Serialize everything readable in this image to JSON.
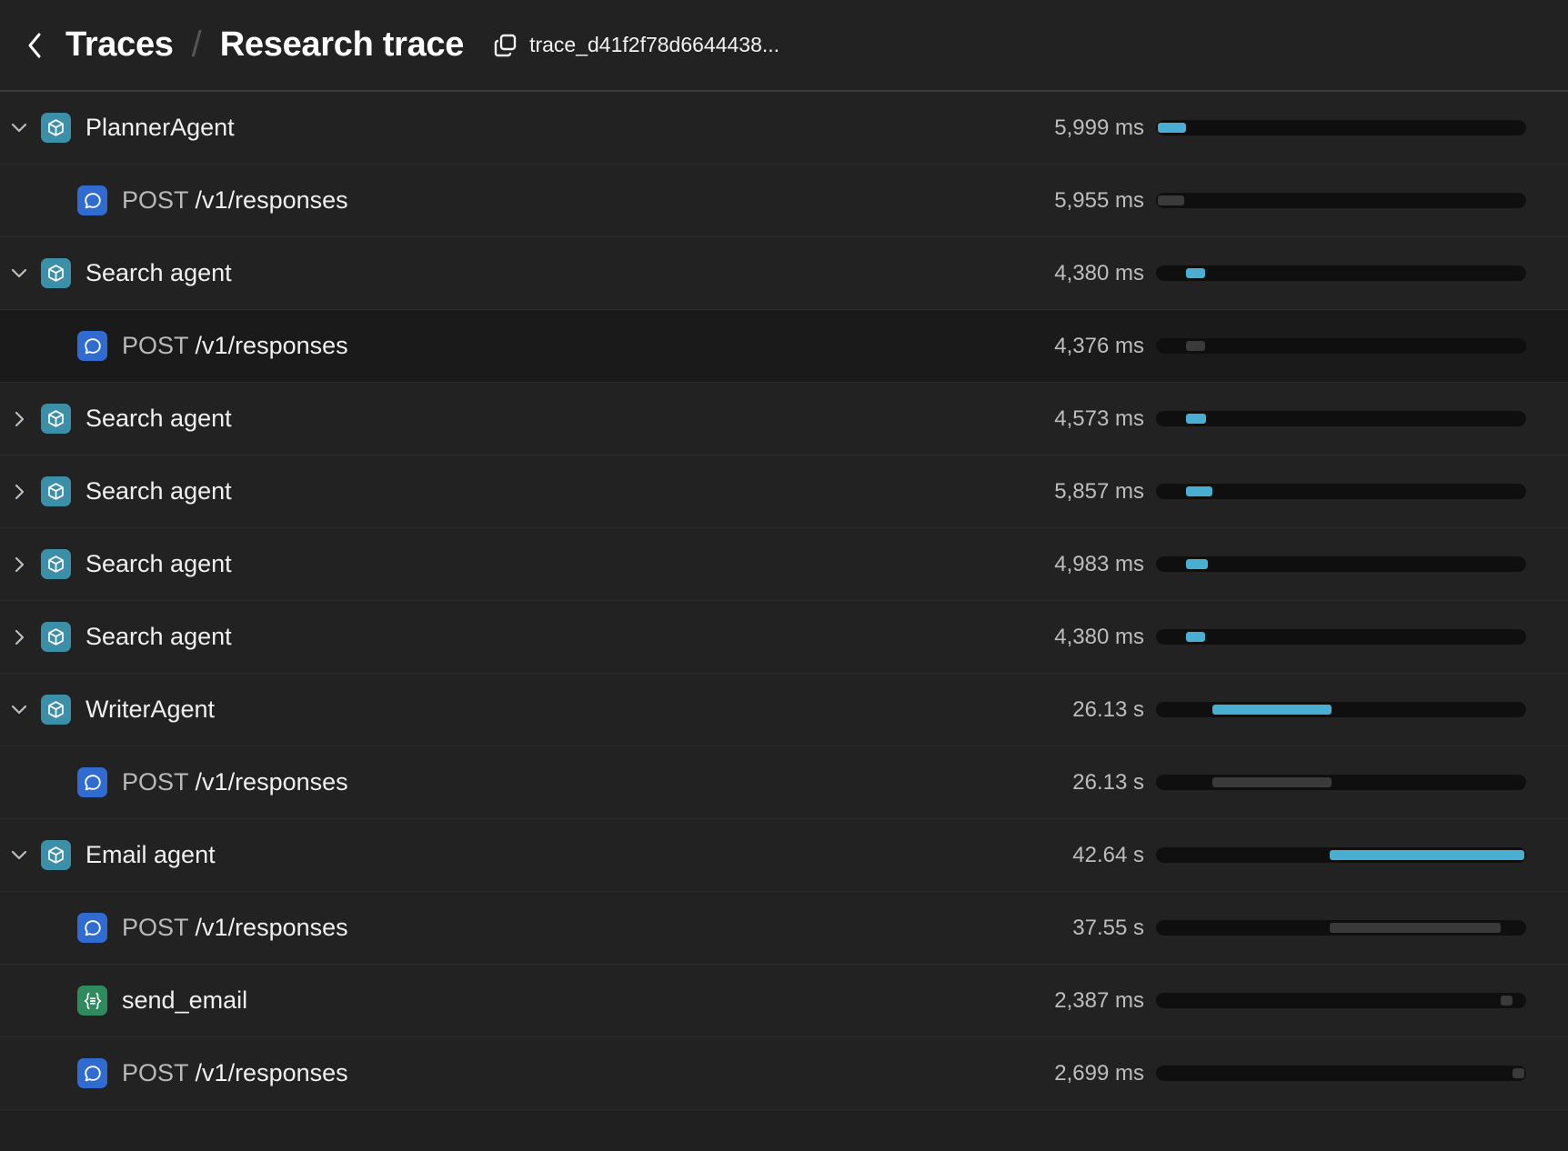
{
  "header": {
    "back_icon": "chevron-left-icon",
    "breadcrumb_root": "Traces",
    "breadcrumb_separator": "/",
    "title": "Research trace",
    "copy_icon": "copy-icon",
    "trace_id": "trace_d41f2f78d6644438..."
  },
  "colors": {
    "background": "#202020",
    "agent_icon": "#3c8fa8",
    "response_icon": "#2f6bd0",
    "function_icon": "#2f8a5e",
    "bar_active": "#4aaed0",
    "bar_inactive": "#3a3a3a",
    "bar_track": "#0f0f0f"
  },
  "spans": [
    {
      "kind": "agent",
      "level": 1,
      "expand": "expanded",
      "method": "",
      "name": "PlannerAgent",
      "duration": "5,999 ms",
      "bar_start": 0.005,
      "bar_width": 0.075,
      "bar_color": "blue",
      "selected": false
    },
    {
      "kind": "response",
      "level": 2,
      "expand": "none",
      "method": "POST",
      "name": "/v1/responses",
      "duration": "5,955 ms",
      "bar_start": 0.005,
      "bar_width": 0.072,
      "bar_color": "gray",
      "selected": false
    },
    {
      "kind": "agent",
      "level": 1,
      "expand": "expanded",
      "method": "",
      "name": "Search agent",
      "duration": "4,380 ms",
      "bar_start": 0.08,
      "bar_width": 0.053,
      "bar_color": "blue",
      "selected": false
    },
    {
      "kind": "response",
      "level": 2,
      "expand": "none",
      "method": "POST",
      "name": "/v1/responses",
      "duration": "4,376 ms",
      "bar_start": 0.08,
      "bar_width": 0.053,
      "bar_color": "gray",
      "selected": true
    },
    {
      "kind": "agent",
      "level": 1,
      "expand": "collapsed",
      "method": "",
      "name": "Search agent",
      "duration": "4,573 ms",
      "bar_start": 0.08,
      "bar_width": 0.055,
      "bar_color": "blue",
      "selected": false
    },
    {
      "kind": "agent",
      "level": 1,
      "expand": "collapsed",
      "method": "",
      "name": "Search agent",
      "duration": "5,857 ms",
      "bar_start": 0.08,
      "bar_width": 0.072,
      "bar_color": "blue",
      "selected": false
    },
    {
      "kind": "agent",
      "level": 1,
      "expand": "collapsed",
      "method": "",
      "name": "Search agent",
      "duration": "4,983 ms",
      "bar_start": 0.08,
      "bar_width": 0.06,
      "bar_color": "blue",
      "selected": false
    },
    {
      "kind": "agent",
      "level": 1,
      "expand": "collapsed",
      "method": "",
      "name": "Search agent",
      "duration": "4,380 ms",
      "bar_start": 0.08,
      "bar_width": 0.053,
      "bar_color": "blue",
      "selected": false
    },
    {
      "kind": "agent",
      "level": 1,
      "expand": "expanded",
      "method": "",
      "name": "WriterAgent",
      "duration": "26.13 s",
      "bar_start": 0.153,
      "bar_width": 0.32,
      "bar_color": "blue",
      "selected": false
    },
    {
      "kind": "response",
      "level": 2,
      "expand": "none",
      "method": "POST",
      "name": "/v1/responses",
      "duration": "26.13 s",
      "bar_start": 0.153,
      "bar_width": 0.32,
      "bar_color": "gray",
      "selected": false
    },
    {
      "kind": "agent",
      "level": 1,
      "expand": "expanded",
      "method": "",
      "name": "Email agent",
      "duration": "42.64 s",
      "bar_start": 0.47,
      "bar_width": 0.525,
      "bar_color": "blue",
      "selected": false
    },
    {
      "kind": "response",
      "level": 2,
      "expand": "none",
      "method": "POST",
      "name": "/v1/responses",
      "duration": "37.55 s",
      "bar_start": 0.47,
      "bar_width": 0.462,
      "bar_color": "gray",
      "selected": false
    },
    {
      "kind": "function",
      "level": 2,
      "expand": "none",
      "method": "",
      "name": "send_email",
      "duration": "2,387 ms",
      "bar_start": 0.932,
      "bar_width": 0.03,
      "bar_color": "gray",
      "selected": false
    },
    {
      "kind": "response",
      "level": 2,
      "expand": "none",
      "method": "POST",
      "name": "/v1/responses",
      "duration": "2,699 ms",
      "bar_start": 0.962,
      "bar_width": 0.033,
      "bar_color": "gray",
      "selected": false
    }
  ]
}
